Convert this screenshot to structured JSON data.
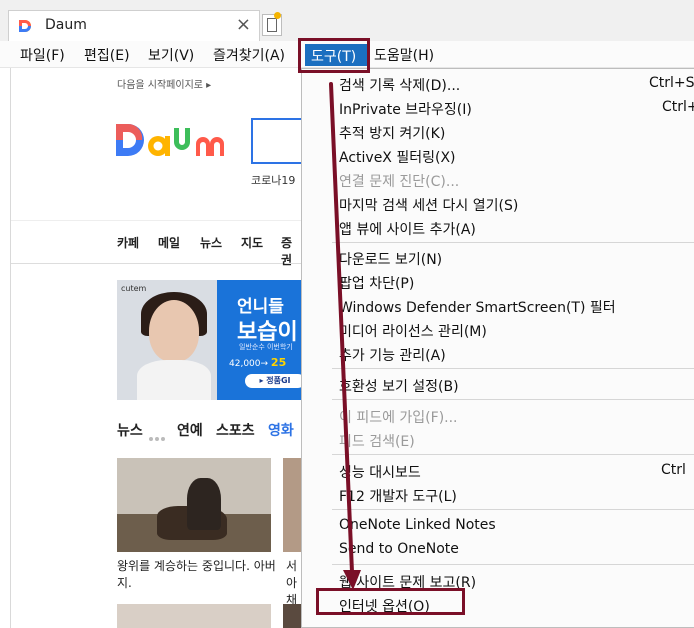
{
  "browser": {
    "tab_title": "Daum",
    "tab_close": "×"
  },
  "menubar": {
    "file": "파일(F)",
    "edit": "편집(E)",
    "view": "보기(V)",
    "favorites": "즐겨찾기(A)",
    "tools": "도구(T)",
    "help": "도움말(H)"
  },
  "page": {
    "set_home": "다음을 시작페이지로 ▸",
    "corona": "코로나19",
    "nav": [
      "카페",
      "메일",
      "뉴스",
      "지도",
      "증권"
    ],
    "banner": {
      "brand": "cutem",
      "title1": "언니들",
      "title2": "보습이",
      "subtitle": "일반순수 이번학기",
      "price_old": "42,000→",
      "price_new": "25",
      "button": "▸ 정품GI"
    },
    "news_tabs": [
      "뉴스",
      "연예",
      "스포츠",
      "영화"
    ],
    "news_tab_active": "영화",
    "caption1": "왕위를 계승하는 중입니다. 아버지.",
    "caption2": "서아 채겨"
  },
  "tools_menu": {
    "items": [
      {
        "label": "검색 기록 삭제(D)...",
        "shortcut": "Ctrl+Sh",
        "disabled": false
      },
      {
        "label": "InPrivate 브라우징(I)",
        "shortcut": "Ctrl+",
        "disabled": false
      },
      {
        "label": "추적 방지 켜기(K)",
        "shortcut": "",
        "disabled": false
      },
      {
        "label": "ActiveX 필터링(X)",
        "shortcut": "",
        "disabled": false
      },
      {
        "label": "연결 문제 진단(C)...",
        "shortcut": "",
        "disabled": true
      },
      {
        "label": "마지막 검색 세션 다시 열기(S)",
        "shortcut": "",
        "disabled": false
      },
      {
        "label": "앱 뷰에 사이트 추가(A)",
        "shortcut": "",
        "disabled": false
      },
      {
        "label": "다운로드 보기(N)",
        "shortcut": "",
        "disabled": false
      },
      {
        "label": "팝업 차단(P)",
        "shortcut": "",
        "disabled": false
      },
      {
        "label": "Windows Defender SmartScreen(T) 필터",
        "shortcut": "",
        "disabled": false
      },
      {
        "label": "미디어 라이선스 관리(M)",
        "shortcut": "",
        "disabled": false
      },
      {
        "label": "추가 기능 관리(A)",
        "shortcut": "",
        "disabled": false
      },
      {
        "label": "호환성 보기 설정(B)",
        "shortcut": "",
        "disabled": false
      },
      {
        "label": "이 피드에 가입(F)...",
        "shortcut": "",
        "disabled": true
      },
      {
        "label": "피드 검색(E)",
        "shortcut": "",
        "disabled": true
      },
      {
        "label": "성능 대시보드",
        "shortcut": "Ctrl",
        "disabled": false
      },
      {
        "label": "F12 개발자 도구(L)",
        "shortcut": "",
        "disabled": false
      },
      {
        "label": "OneNote Linked Notes",
        "shortcut": "",
        "disabled": false
      },
      {
        "label": "Send to OneNote",
        "shortcut": "",
        "disabled": false
      },
      {
        "label": "웹 사이트 문제 보고(R)",
        "shortcut": "",
        "disabled": false
      },
      {
        "label": "인터넷 옵션(O)",
        "shortcut": "",
        "disabled": false
      }
    ]
  },
  "colors": {
    "highlight_box": "#7a0f27",
    "menu_selected": "#1b6fc0",
    "daum_blue": "#2d73e5"
  }
}
